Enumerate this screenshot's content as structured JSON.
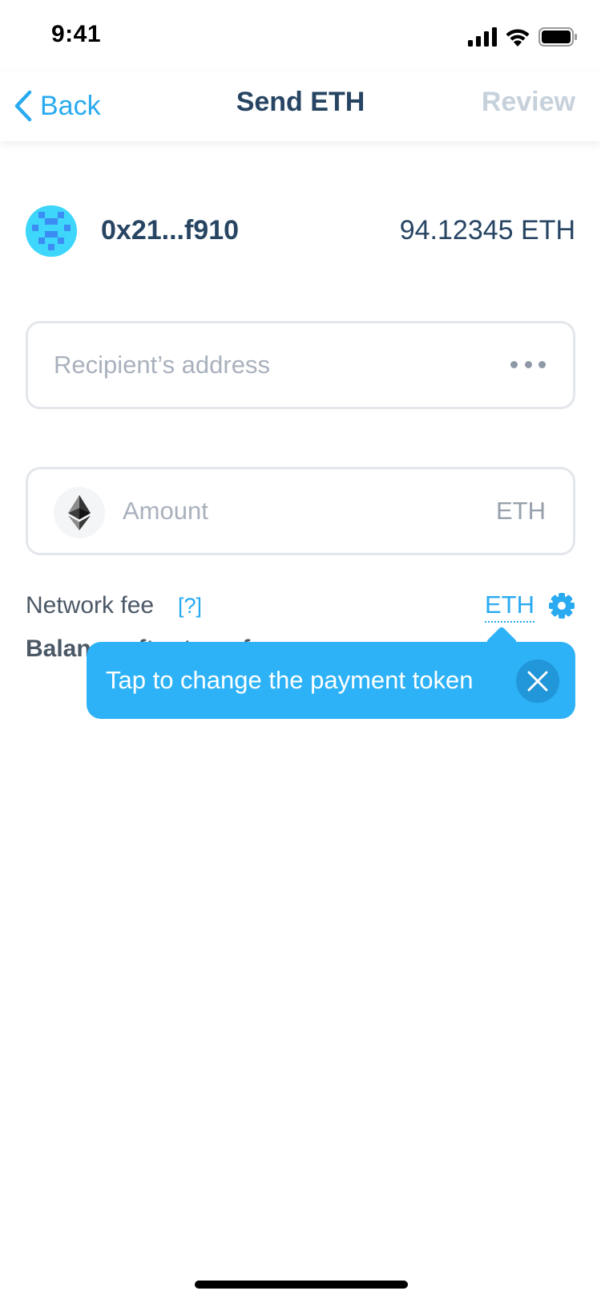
{
  "status_bar": {
    "time": "9:41",
    "icons": [
      "signal-icon",
      "wifi-icon",
      "battery-icon"
    ]
  },
  "nav": {
    "back_label": "Back",
    "title": "Send ETH",
    "review_label": "Review"
  },
  "account": {
    "address": "0x21...f910",
    "balance": "94.12345 ETH"
  },
  "recipient": {
    "placeholder": "Recipient’s address",
    "value": ""
  },
  "amount": {
    "placeholder": "Amount",
    "value": "",
    "unit": "ETH"
  },
  "fee": {
    "label": "Network fee",
    "help": "[?]",
    "token": "ETH"
  },
  "balance_after": {
    "label": "Balance after transfer"
  },
  "tooltip": {
    "text": "Tap to change the payment token"
  },
  "colors": {
    "accent": "#29aaf1",
    "tooltip": "#2eb2f7",
    "text_primary": "#274563",
    "disabled": "#c6d1db"
  }
}
